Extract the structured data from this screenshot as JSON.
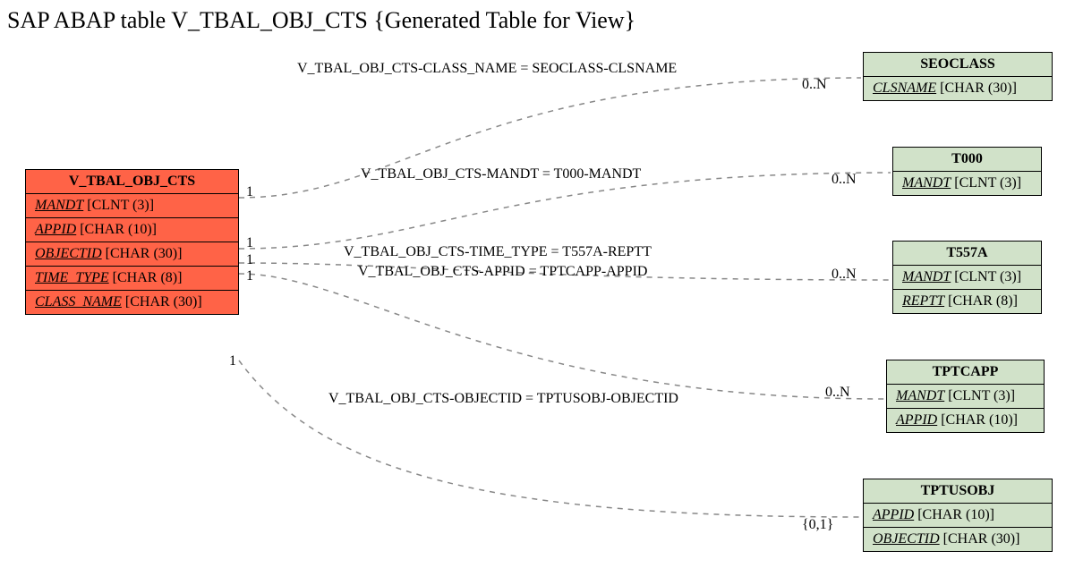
{
  "title": "SAP ABAP table V_TBAL_OBJ_CTS {Generated Table for View}",
  "main_entity": {
    "name": "V_TBAL_OBJ_CTS",
    "fields": [
      {
        "key": "MANDT",
        "type": "[CLNT (3)]"
      },
      {
        "key": "APPID",
        "type": "[CHAR (10)]"
      },
      {
        "key": "OBJECTID",
        "type": "[CHAR (30)]"
      },
      {
        "key": "TIME_TYPE",
        "type": "[CHAR (8)]"
      },
      {
        "key": "CLASS_NAME",
        "type": "[CHAR (30)]"
      }
    ]
  },
  "related": [
    {
      "name": "SEOCLASS",
      "fields": [
        {
          "key": "CLSNAME",
          "type": "[CHAR (30)]"
        }
      ]
    },
    {
      "name": "T000",
      "fields": [
        {
          "key": "MANDT",
          "type": "[CLNT (3)]"
        }
      ]
    },
    {
      "name": "T557A",
      "fields": [
        {
          "key": "MANDT",
          "type": "[CLNT (3)]"
        },
        {
          "key": "REPTT",
          "type": "[CHAR (8)]"
        }
      ]
    },
    {
      "name": "TPTCAPP",
      "fields": [
        {
          "key": "MANDT",
          "type": "[CLNT (3)]"
        },
        {
          "key": "APPID",
          "type": "[CHAR (10)]"
        }
      ]
    },
    {
      "name": "TPTUSOBJ",
      "fields": [
        {
          "key": "APPID",
          "type": "[CHAR (10)]"
        },
        {
          "key": "OBJECTID",
          "type": "[CHAR (30)]"
        }
      ]
    }
  ],
  "relations": [
    {
      "label": "V_TBAL_OBJ_CTS-CLASS_NAME = SEOCLASS-CLSNAME",
      "left_card": "1",
      "right_card": "0..N"
    },
    {
      "label": "V_TBAL_OBJ_CTS-MANDT = T000-MANDT",
      "left_card": "1",
      "right_card": "0..N"
    },
    {
      "label": "V_TBAL_OBJ_CTS-TIME_TYPE = T557A-REPTT",
      "left_card": "1",
      "right_card": "0..N"
    },
    {
      "label": "V_TBAL_OBJ_CTS-APPID = TPTCAPP-APPID",
      "left_card": "1",
      "right_card": "0..N"
    },
    {
      "label": "V_TBAL_OBJ_CTS-OBJECTID = TPTUSOBJ-OBJECTID",
      "left_card": "1",
      "right_card": "{0,1}"
    }
  ]
}
